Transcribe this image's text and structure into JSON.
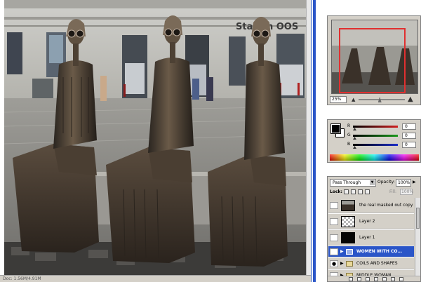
{
  "document": {
    "status_text": "Doc: 1.56M/4.91M"
  },
  "photo": {
    "storefront_sign": "Station OOS"
  },
  "navigator": {
    "zoom_value": "25%",
    "zoom_fraction": 0.45
  },
  "color": {
    "foreground": "#000000",
    "background": "#ffffff",
    "channels": [
      {
        "label": "R",
        "value": "0",
        "color": "#d22020"
      },
      {
        "label": "G",
        "value": "0",
        "color": "#1c9a1c"
      },
      {
        "label": "B",
        "value": "0",
        "color": "#1e2ec8"
      }
    ]
  },
  "layers": {
    "blend_mode": "Pass Through",
    "opacity_label": "Opacity:",
    "opacity_value": "100%",
    "lock_label": "Lock:",
    "fill_label": "Fill:",
    "fill_value": "100%",
    "items": [
      {
        "name": "the real masked out copy",
        "visible": false,
        "thumb": "photo",
        "type": "layer",
        "selected": false
      },
      {
        "name": "Layer 2",
        "visible": false,
        "thumb": "transparent",
        "type": "layer",
        "selected": false
      },
      {
        "name": "Layer 1",
        "visible": false,
        "thumb": "black",
        "type": "layer",
        "selected": false
      },
      {
        "name": "WOMEN WITH CO...",
        "visible": true,
        "thumb": "folder",
        "type": "group",
        "selected": true
      },
      {
        "name": "COILS AND SHAPES",
        "visible": true,
        "thumb": "folder",
        "type": "group",
        "selected": false
      },
      {
        "name": "MIDDLE WOMAN",
        "visible": false,
        "thumb": "folder",
        "type": "group",
        "selected": false
      }
    ]
  },
  "colors": {
    "accent_blue": "#2a55c8",
    "panel_gray": "#d4d0c8",
    "nav_box_red": "#e03030"
  }
}
